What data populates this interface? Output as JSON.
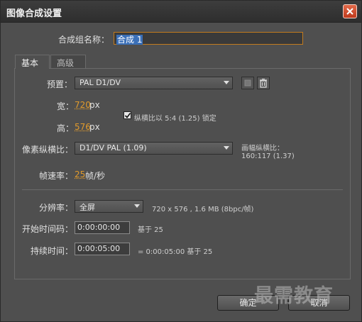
{
  "window": {
    "title": "图像合成设置"
  },
  "composition_name": {
    "label": "合成组名称：",
    "value": "合成 1"
  },
  "tabs": [
    {
      "label": "基本"
    },
    {
      "label": "高级"
    }
  ],
  "preset": {
    "label": "预置：",
    "value": "PAL D1/DV"
  },
  "width": {
    "label": "宽：",
    "value": "720",
    "unit": "px"
  },
  "height": {
    "label": "高：",
    "value": "576",
    "unit": "px"
  },
  "lock_aspect": {
    "label": "纵横比以 5:4 (1.25) 锁定",
    "checked": true
  },
  "pixel_aspect": {
    "label": "像素纵横比：",
    "value": "D1/DV PAL (1.09)",
    "frame_aspect_label": "画幅纵横比：",
    "frame_aspect_value": "160:117 (1.37)"
  },
  "frame_rate": {
    "label": "帧速率：",
    "value": "25",
    "unit": "帧/秒"
  },
  "resolution": {
    "label": "分辨率：",
    "value": "全屏",
    "info": "720 x 576 , 1.6 MB (8bpc/帧)"
  },
  "start_timecode": {
    "label": "开始时间码：",
    "value": "0:00:00:00",
    "base": "基于 25"
  },
  "duration": {
    "label": "持续时间：",
    "value": "0:00:05:00",
    "info": "= 0:00:05:00  基于 25"
  },
  "buttons": {
    "ok": "确定",
    "cancel": "取消"
  },
  "watermark": "最需教育",
  "colors": {
    "accent": "#e09a2c",
    "selection": "#3b70b8",
    "close": "#d24e2e"
  }
}
